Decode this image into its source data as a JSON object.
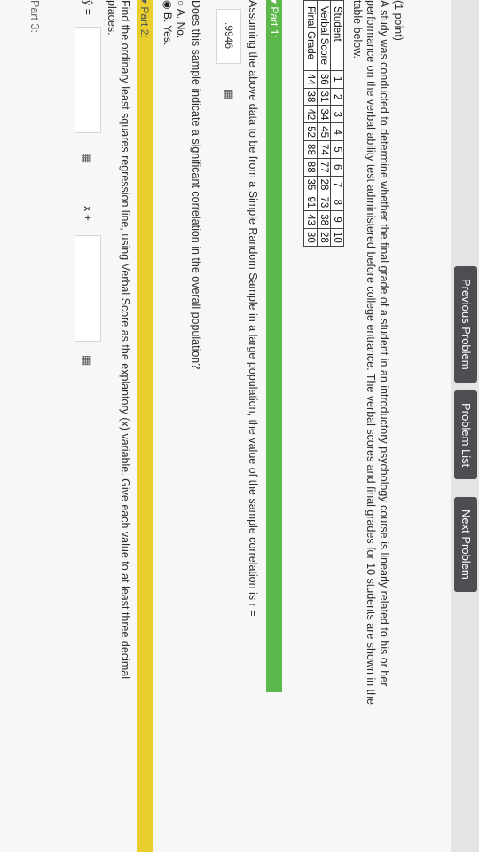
{
  "nav": {
    "prev_label": "Previous Problem",
    "list_label": "Problem List",
    "next_label": "Next Problem"
  },
  "problem": {
    "points": "(1 point)",
    "line1": "A study was conducted to determine whether the final grade of a student in an introductory psychology course is linearly related to his or her",
    "line2": "performance on the verbal ability test administered before college entrance. The verbal scores and final grades for 10 students are shown in the",
    "line3": "table below."
  },
  "table": {
    "row_headers": [
      "Student",
      "Verbal Score",
      "Final Grade"
    ],
    "student": [
      "1",
      "2",
      "3",
      "4",
      "5",
      "6",
      "7",
      "8",
      "9",
      "10"
    ],
    "verbal": [
      "36",
      "31",
      "34",
      "45",
      "74",
      "77",
      "28",
      "73",
      "38",
      "28"
    ],
    "final": [
      "44",
      "38",
      "42",
      "52",
      "88",
      "88",
      "35",
      "91",
      "43",
      "30"
    ]
  },
  "part1": {
    "label": "▾ Part 1:",
    "question": "Assuming the above data to be from a Simple Random Sample in a large population, the value of the sample correlation is r =",
    "answer": ".9946",
    "q2": "Does this sample indicate a significant correlation in the overall population?",
    "opt_a": "A. No.",
    "opt_b": "B. Yes."
  },
  "part2": {
    "label": "▾ Part 2:",
    "line1": "Find the ordinary least squares regression line, using Verbal Score as the explantory (x) variable. Give each value to at least three decimal",
    "line2": "places.",
    "yhat": "ŷ =",
    "xplus": "x +"
  },
  "part3": {
    "label": "Part 3:"
  },
  "colors": {
    "part1_bar": "#5cb84a",
    "part2_bar": "#e9cf2e",
    "nav": "#4e4e52"
  }
}
